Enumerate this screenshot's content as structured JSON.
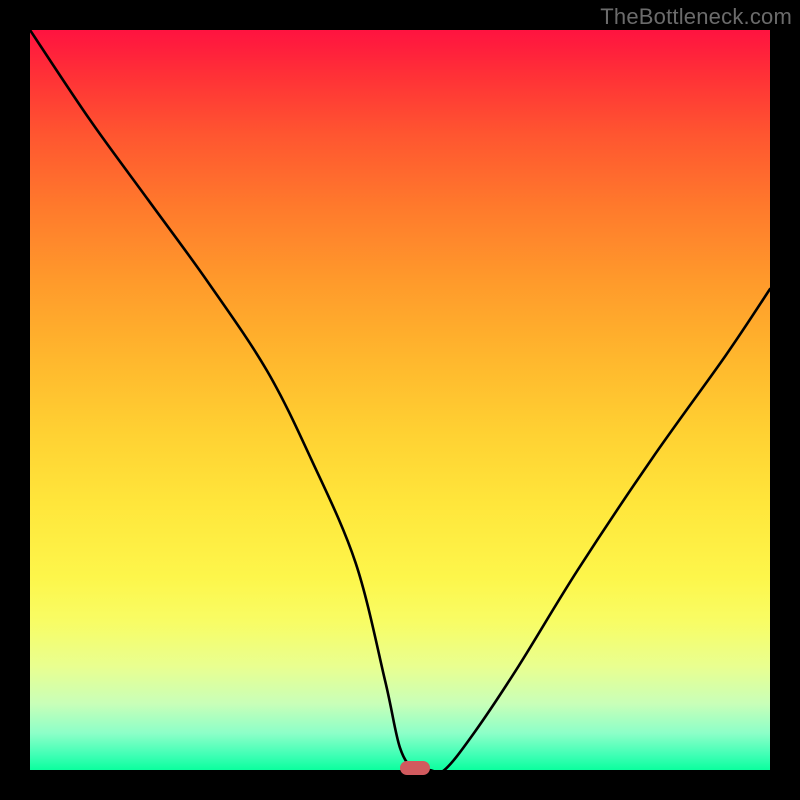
{
  "watermark": "TheBottleneck.com",
  "chart_data": {
    "type": "line",
    "title": "",
    "xlabel": "",
    "ylabel": "",
    "xlim": [
      0,
      100
    ],
    "ylim": [
      0,
      100
    ],
    "grid": false,
    "legend": false,
    "series": [
      {
        "name": "curve",
        "x": [
          0,
          8,
          16,
          24,
          32,
          38,
          44,
          48,
          50,
          52,
          54,
          56,
          60,
          66,
          74,
          84,
          94,
          100
        ],
        "values": [
          100,
          88,
          77,
          66,
          54,
          42,
          28,
          12,
          3,
          0,
          0,
          0,
          5,
          14,
          27,
          42,
          56,
          65
        ]
      }
    ],
    "marker": {
      "x": 52,
      "y": 0
    },
    "background": {
      "type": "vertical-gradient",
      "stops": [
        {
          "pos": 0,
          "color": "#ff1340"
        },
        {
          "pos": 50,
          "color": "#ffd032"
        },
        {
          "pos": 85,
          "color": "#f8fd65"
        },
        {
          "pos": 100,
          "color": "#0bff9e"
        }
      ]
    }
  }
}
